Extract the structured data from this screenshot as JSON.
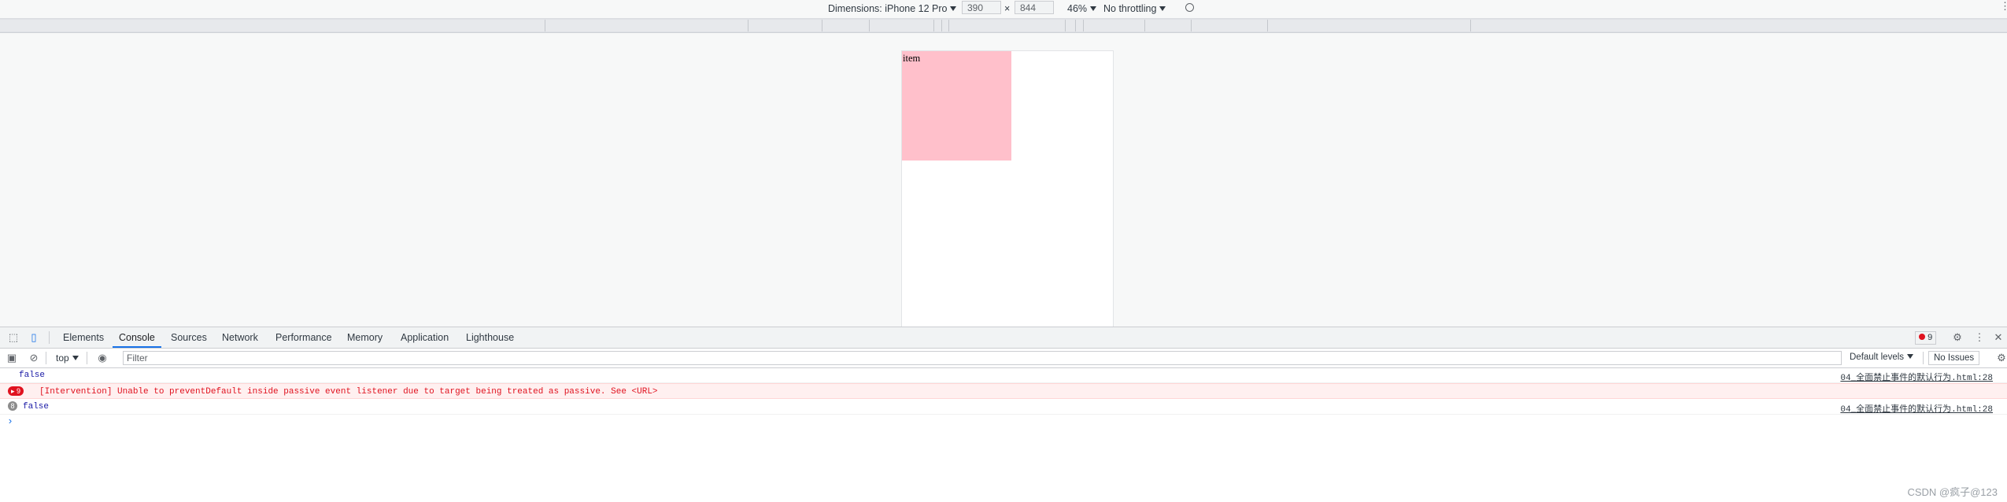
{
  "device_toolbar": {
    "dimensions_label": "Dimensions: iPhone 12 Pro",
    "width": "390",
    "times": "×",
    "height": "844",
    "zoom": "46%",
    "throttling": "No throttling"
  },
  "page": {
    "item_text": "item",
    "item_color": "#ffc0cb"
  },
  "devtools": {
    "tabs": [
      "Elements",
      "Console",
      "Sources",
      "Network",
      "Performance",
      "Memory",
      "Application",
      "Lighthouse"
    ],
    "active_tab": "Console",
    "error_count": "9",
    "context": "top",
    "filter_placeholder": "Filter",
    "levels": "Default levels",
    "issues": "No Issues"
  },
  "console": {
    "rows": [
      {
        "text": "false",
        "source": "04_全面禁止事件的默认行为.html:28"
      },
      {
        "count": "9",
        "text": "[Intervention] Unable to preventDefault inside passive event listener due to target being treated as passive. See <URL>"
      },
      {
        "count": "8",
        "text": "false",
        "source": "04_全面禁止事件的默认行为.html:28"
      }
    ],
    "prompt": "›"
  },
  "watermark": "CSDN @疯子@123",
  "colors": {
    "accent": "#1a73e8",
    "error": "#e0121f"
  }
}
